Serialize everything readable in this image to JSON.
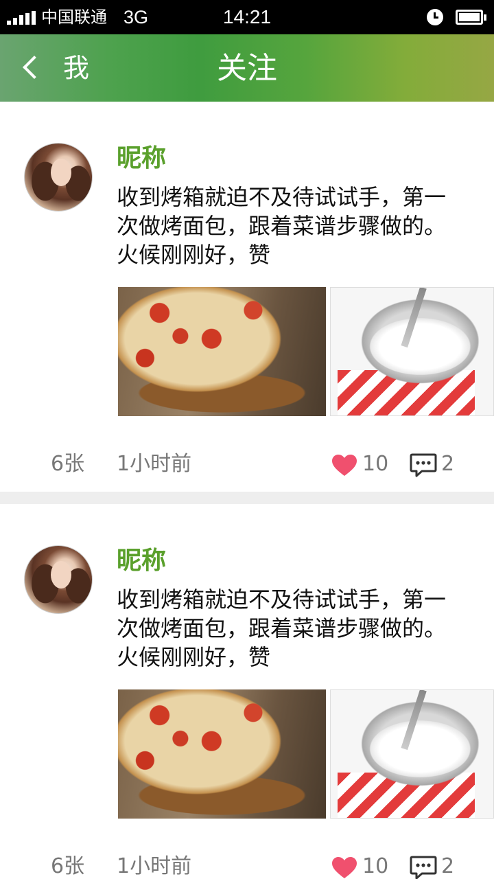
{
  "status_bar": {
    "carrier": "中国联通",
    "network": "3G",
    "time": "14:21"
  },
  "nav": {
    "back_label": "我",
    "title": "关注"
  },
  "colors": {
    "accent": "#5aa02c",
    "like": "#f0506e",
    "meta_text": "#777777"
  },
  "posts": [
    {
      "nickname": "昵称",
      "text": "收到烤箱就迫不及待试试手，第一次做烤面包，跟着菜谱步骤做的。火候刚刚好，赞",
      "photos": [
        "pizza-photo",
        "mixing-bowl-photo"
      ],
      "photo_count": "6张",
      "time": "1小时前",
      "likes": "10",
      "comments": "2"
    },
    {
      "nickname": "昵称",
      "text": "收到烤箱就迫不及待试试手，第一次做烤面包，跟着菜谱步骤做的。火候刚刚好，赞",
      "photos": [
        "pizza-photo",
        "mixing-bowl-photo"
      ],
      "photo_count": "6张",
      "time": "1小时前",
      "likes": "10",
      "comments": "2"
    }
  ]
}
